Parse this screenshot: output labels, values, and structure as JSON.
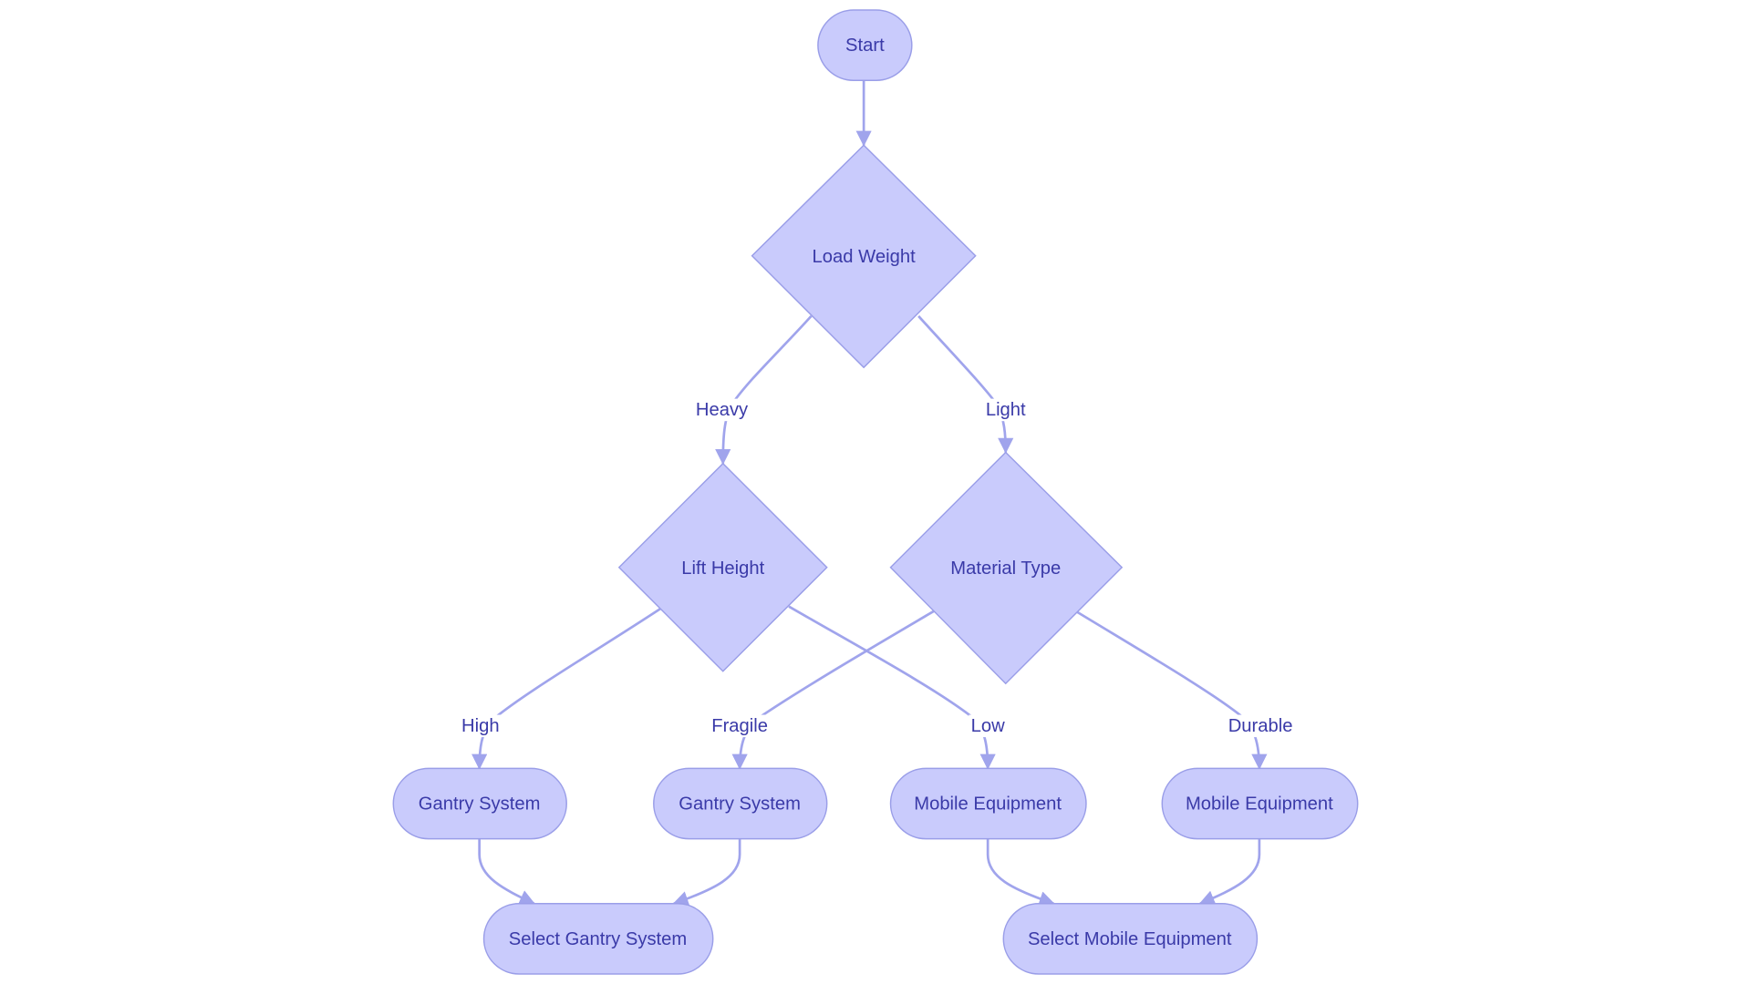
{
  "colors": {
    "node_fill": "#c9cbfc",
    "node_stroke": "#9a9ee8",
    "edge": "#a0a4ec",
    "text": "#3a3aa8"
  },
  "nodes": {
    "start": "Start",
    "load_weight": "Load Weight",
    "lift_height": "Lift Height",
    "material_type": "Material Type",
    "gantry_1": "Gantry System",
    "gantry_2": "Gantry System",
    "mobile_1": "Mobile Equipment",
    "mobile_2": "Mobile Equipment",
    "select_gantry": "Select Gantry System",
    "select_mobile": "Select Mobile Equipment"
  },
  "edge_labels": {
    "heavy": "Heavy",
    "light": "Light",
    "high": "High",
    "low": "Low",
    "fragile": "Fragile",
    "durable": "Durable"
  }
}
